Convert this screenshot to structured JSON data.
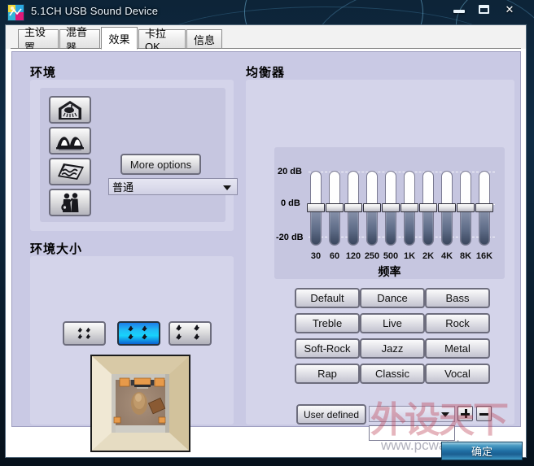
{
  "window": {
    "title": "5.1CH USB Sound Device",
    "icon": "app-icon",
    "minimize_label": "",
    "maximize_label": "",
    "close_label": "✕"
  },
  "tabs": [
    {
      "label": "主设置",
      "active": false
    },
    {
      "label": "混音器",
      "active": false
    },
    {
      "label": "效果",
      "active": true
    },
    {
      "label": "卡拉 OK",
      "active": false
    },
    {
      "label": "信息",
      "active": false
    }
  ],
  "environment": {
    "title": "环境",
    "icons": [
      {
        "name": "bathroom-icon"
      },
      {
        "name": "arena-icon"
      },
      {
        "name": "carpet-icon"
      },
      {
        "name": "concert-icon"
      }
    ],
    "more_options_label": "More options",
    "selected_preset": "普通"
  },
  "environment_size": {
    "title": "环境大小",
    "options": [
      {
        "name": "room-small",
        "selected": false
      },
      {
        "name": "room-medium",
        "selected": true
      },
      {
        "name": "room-large",
        "selected": false
      }
    ],
    "preview_name": "room-preview-image"
  },
  "equalizer": {
    "title": "均衡器",
    "freq_axis_title": "频率",
    "db_labels": [
      "20 dB",
      "0  dB",
      "-20 dB"
    ],
    "presets": [
      "Default",
      "Dance",
      "Bass",
      "Treble",
      "Live",
      "Rock",
      "Soft-Rock",
      "Jazz",
      "Metal",
      "Rap",
      "Classic",
      "Vocal"
    ],
    "user_defined_label": "User defined",
    "user_select_value": "",
    "user_input_value": "",
    "add_label": "+",
    "remove_label": "−"
  },
  "chart_data": {
    "type": "bar",
    "title": "均衡器",
    "xlabel": "频率",
    "ylabel": "dB",
    "categories": [
      "30",
      "60",
      "120",
      "250",
      "500",
      "1K",
      "2K",
      "4K",
      "8K",
      "16K"
    ],
    "values": [
      0,
      0,
      0,
      0,
      0,
      0,
      0,
      0,
      0,
      0
    ],
    "ylim": [
      -20,
      20
    ],
    "ytick_labels": [
      "20 dB",
      "0  dB",
      "-20 dB"
    ],
    "yticks": [
      20,
      0,
      -20
    ],
    "grid": true,
    "legend": "none"
  },
  "watermark": {
    "text": "外设天下",
    "url": "www.pcwaishe.cn"
  },
  "footer": {
    "ok_label": "确定"
  }
}
